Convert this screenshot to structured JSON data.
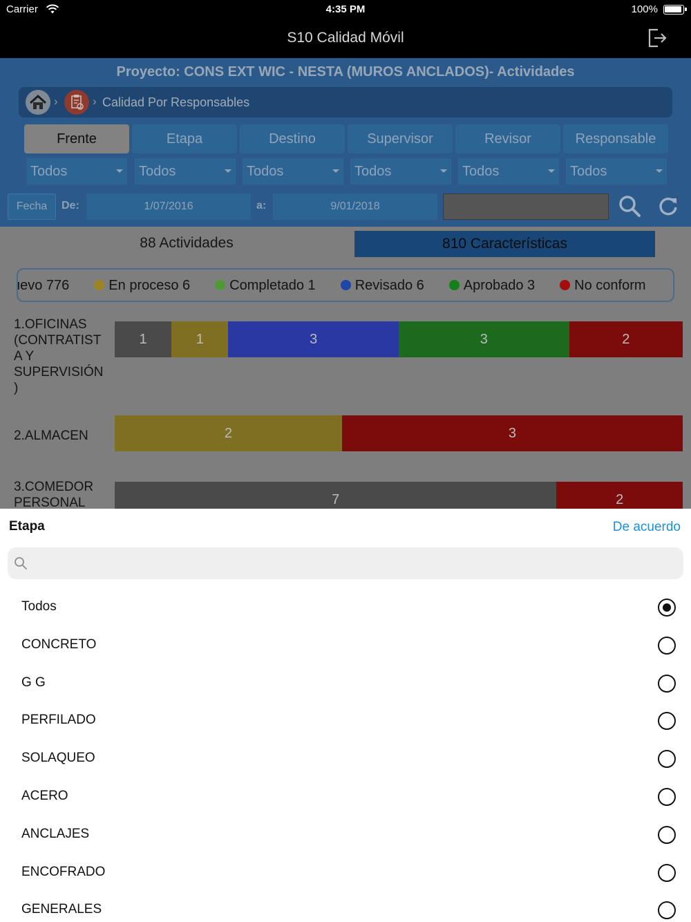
{
  "status_bar": {
    "carrier": "Carrier",
    "time": "4:35 PM",
    "battery": "100%"
  },
  "nav": {
    "title": "S10 Calidad Móvil"
  },
  "project": {
    "title": "Proyecto: CONS EXT WIC - NESTA (MUROS ANCLADOS)- Actividades"
  },
  "breadcrumb": {
    "current": "Calidad Por Responsables"
  },
  "tabs": [
    {
      "label": "Frente",
      "active": true
    },
    {
      "label": "Etapa",
      "active": false
    },
    {
      "label": "Destino",
      "active": false
    },
    {
      "label": "Supervisor",
      "active": false
    },
    {
      "label": "Revisor",
      "active": false
    },
    {
      "label": "Responsable",
      "active": false
    }
  ],
  "filters": [
    "Todos",
    "Todos",
    "Todos",
    "Todos",
    "Todos",
    "Todos"
  ],
  "date_filter": {
    "button": "Fecha",
    "from_label": "De:",
    "from": "1/07/2016",
    "to_label": "a:",
    "to": "9/01/2018"
  },
  "counts": {
    "activities": "88 Actividades",
    "characteristics": "810 Características"
  },
  "legend": [
    {
      "label": "uevo 776",
      "color": "#7e7e7e"
    },
    {
      "label": "En proceso 6",
      "color": "#9a8423"
    },
    {
      "label": "Completado 1",
      "color": "#4e9a35"
    },
    {
      "label": "Revisado 6",
      "color": "#1e45a8"
    },
    {
      "label": "Aprobado 3",
      "color": "#157f1a"
    },
    {
      "label": "No conform",
      "color": "#a20d0d"
    }
  ],
  "chart_data": {
    "type": "bar",
    "orientation": "horizontal-stacked",
    "rows": [
      {
        "label": "1.OFICINAS (CONTRATIST A Y SUPERVISIÓN )",
        "segments": [
          {
            "value": 1,
            "color": "#4a4a4a"
          },
          {
            "value": 1,
            "color": "#7f6f22"
          },
          {
            "value": 3,
            "color": "#2a38a3"
          },
          {
            "value": 3,
            "color": "#1c6a1e"
          },
          {
            "value": 2,
            "color": "#7c0b0b"
          }
        ]
      },
      {
        "label": "2.ALMACEN",
        "segments": [
          {
            "value": 2,
            "color": "#7f6f22"
          },
          {
            "value": 3,
            "color": "#7c0b0b"
          }
        ]
      },
      {
        "label": "3.COMEDOR PERSONAL",
        "segments": [
          {
            "value": 7,
            "color": "#4a4a4a"
          },
          {
            "value": 2,
            "color": "#7c0b0b"
          }
        ]
      }
    ]
  },
  "picker": {
    "title": "Etapa",
    "done": "De acuerdo",
    "search_placeholder": "",
    "options": [
      {
        "label": "Todos",
        "selected": true
      },
      {
        "label": "CONCRETO",
        "selected": false
      },
      {
        "label": "G G",
        "selected": false
      },
      {
        "label": "PERFILADO",
        "selected": false
      },
      {
        "label": "SOLAQUEO",
        "selected": false
      },
      {
        "label": "ACERO",
        "selected": false
      },
      {
        "label": "ANCLAJES",
        "selected": false
      },
      {
        "label": "ENCOFRADO",
        "selected": false
      },
      {
        "label": "GENERALES",
        "selected": false
      }
    ]
  }
}
